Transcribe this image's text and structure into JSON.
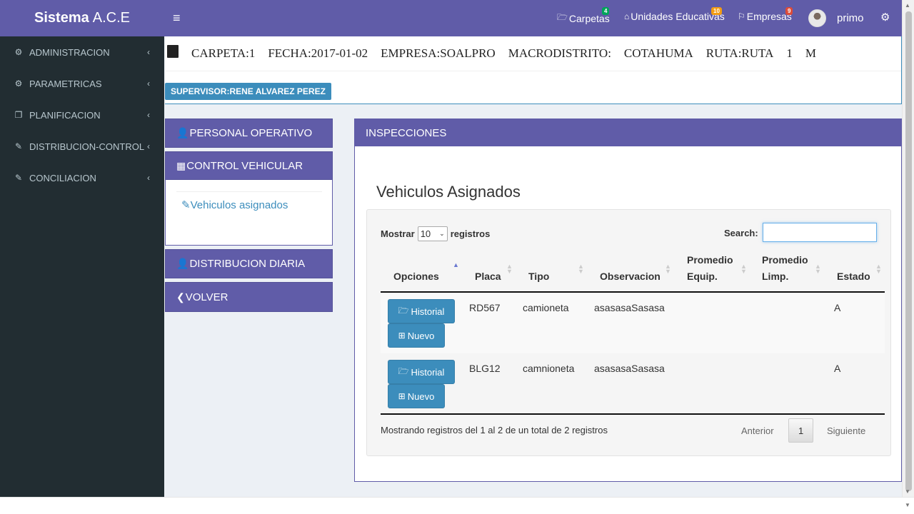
{
  "brand": {
    "bold": "Sistema",
    "rest": "A.C.E"
  },
  "sidebar": {
    "items": [
      {
        "label": "ADMINISTRACION",
        "icon": "cogs-icon"
      },
      {
        "label": "PARAMETRICAS",
        "icon": "cogs-icon"
      },
      {
        "label": "PLANIFICACION",
        "icon": "copy-icon"
      },
      {
        "label": "DISTRIBUCION-CONTROL",
        "icon": "edit-icon"
      },
      {
        "label": "CONCILIACION",
        "icon": "edit-icon"
      }
    ]
  },
  "topbar": {
    "carpetas": {
      "label": "Carpetas",
      "badge": "4",
      "badge_color": "#00a65a"
    },
    "unidades": {
      "label": "Unidades Educativas",
      "badge": "10",
      "badge_color": "#f39c12"
    },
    "empresas": {
      "label": "Empresas",
      "badge": "9",
      "badge_color": "#dd4b39"
    },
    "user": "primo"
  },
  "header": {
    "carpeta": "CARPETA:1",
    "fecha": "FECHA:2017-01-02",
    "empresa": "EMPRESA:SOALPRO",
    "macro_label": "MACRODISTRITO:",
    "macro_value": "COTAHUMA",
    "ruta": "RUTA:RUTA",
    "ruta_num": "1",
    "ruta_turno": "M",
    "supervisor": "SUPERVISOR:RENE ALVAREZ PEREZ"
  },
  "left_panels": {
    "personal": "PERSONAL OPERATIVO",
    "control": "CONTROL VEHICULAR",
    "vehiculos_link": "Vehiculos asignados",
    "distribucion": "DISTRIBUCION DIARIA",
    "volver": "VOLVER"
  },
  "inspecciones": {
    "header": "INSPECCIONES",
    "title": "Vehiculos Asignados",
    "show_prefix": "Mostrar",
    "show_value": "10",
    "show_suffix": "registros",
    "search_label": "Search:",
    "search_value": "",
    "columns": {
      "opciones": "Opciones",
      "placa": "Placa",
      "tipo": "Tipo",
      "observacion": "Observacion",
      "prom_equip_1": "Promedio",
      "prom_equip_2": "Equip.",
      "prom_limp_1": "Promedio",
      "prom_limp_2": "Limp.",
      "estado": "Estado"
    },
    "rows": [
      {
        "placa": "RD567",
        "tipo": "camioneta",
        "observacion": "asasasaSasasa",
        "estado": "A"
      },
      {
        "placa": "BLG12",
        "tipo": "camnioneta",
        "observacion": "asasasaSasasa",
        "estado": "A"
      }
    ],
    "btn_historial": "Historial",
    "btn_nuevo": "Nuevo",
    "info": "Mostrando registros del 1 al 2 de un total de 2 registros",
    "prev": "Anterior",
    "page": "1",
    "next": "Siguiente"
  }
}
